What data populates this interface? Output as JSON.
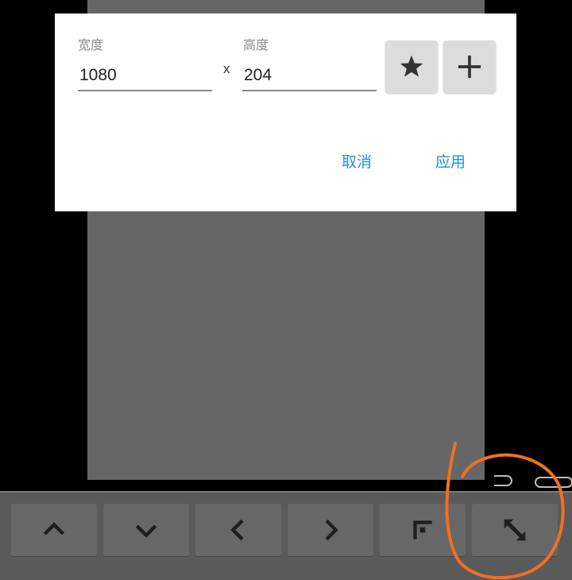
{
  "dialog": {
    "width_label": "宽度",
    "width_value": "1080",
    "separator": "x",
    "height_label": "高度",
    "height_value": "204",
    "favorite_icon": "star-icon",
    "add_icon": "plus-icon",
    "cancel_label": "取消",
    "apply_label": "应用"
  },
  "toolbar": {
    "buttons": [
      {
        "icon": "chevron-up-icon"
      },
      {
        "icon": "chevron-down-icon"
      },
      {
        "icon": "chevron-left-icon"
      },
      {
        "icon": "chevron-right-icon"
      },
      {
        "icon": "corner-top-left-icon"
      },
      {
        "icon": "resize-diagonal-icon"
      }
    ]
  },
  "colors": {
    "accent": "#2a8fd0",
    "annotation": "#f26f22",
    "canvas": "#666666",
    "toolbar": "#5a5a5a"
  }
}
